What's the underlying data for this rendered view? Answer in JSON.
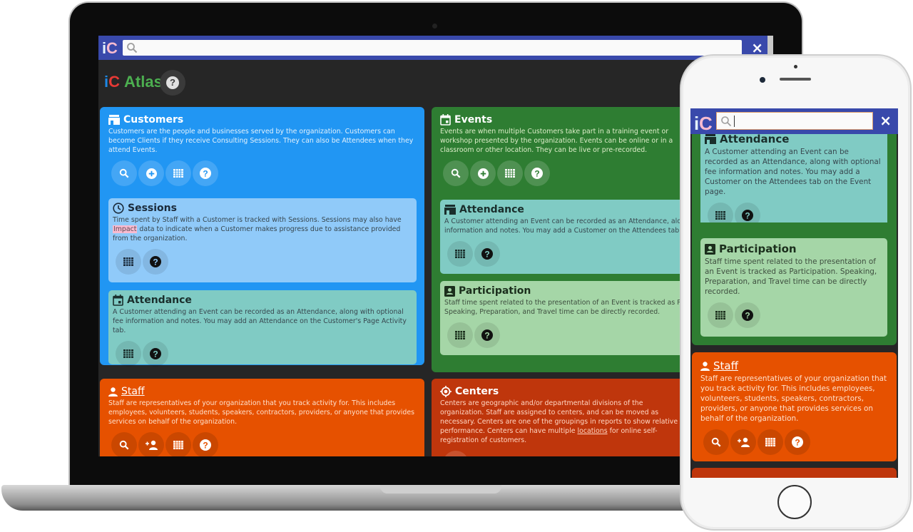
{
  "app": {
    "search": {
      "placeholder": "",
      "value": ""
    },
    "close_label": "×",
    "logo": {
      "i": "i",
      "c": "C"
    },
    "title": {
      "prefix_i": "i",
      "prefix_c": "C",
      "word": "Atlas"
    },
    "help_label": "?"
  },
  "colors": {
    "topbar": "#3949ab",
    "customers": "#2196f3",
    "events": "#2e7d32",
    "staff": "#e65100",
    "centers": "#bf360c",
    "sessions": "#90caf9",
    "attendance": "#80cbc4",
    "participation": "#a5d6a7"
  },
  "laptop": {
    "customers": {
      "title": "Customers",
      "icon": "store-icon",
      "description": "Customers are the people and businesses served by the organization. Customers can become Clients if they receive Consulting Sessions. They can also be Attendees when they attend Events.",
      "buttons": [
        "search",
        "add",
        "grid",
        "help"
      ],
      "sessions": {
        "title": "Sessions",
        "icon": "clock-icon",
        "description_before": "Time spent by Staff with a Customer is tracked with Sessions. Sessions may also have ",
        "highlight": "Impact",
        "description_after": " data to indicate when a Customer makes progress due to assistance provided from the organization.",
        "buttons": [
          "grid",
          "help"
        ]
      },
      "attendance": {
        "title": "Attendance",
        "icon": "calendar-icon",
        "description": "A Customer attending an Event can be recorded as an Attendance, along with optional fee information and notes. You may add an Attendance on the Customer's Page Activity tab.",
        "buttons": [
          "grid",
          "help"
        ]
      }
    },
    "events": {
      "title": "Events",
      "icon": "calendar-icon",
      "description": "Events are when multiple Customers take part in a training event or workshop presented by the organization. Events can be online or in a classroom or other location. They can be live or pre-recorded.",
      "buttons": [
        "search",
        "add",
        "grid",
        "help"
      ],
      "attendance": {
        "title": "Attendance",
        "icon": "store-icon",
        "description": "A Customer attending an Event can be recorded as an Attendance, along with optional fee information and notes. You may add a Customer on the Attendees tab on the Event page.",
        "buttons": [
          "grid",
          "help"
        ]
      },
      "participation": {
        "title": "Participation",
        "icon": "badge-icon",
        "description": "Staff time spent related to the presentation of an Event is tracked as Participation. Speaking, Preparation, and Travel time can be directly recorded.",
        "buttons": [
          "grid",
          "help"
        ]
      }
    },
    "staff": {
      "title": "Staff",
      "icon": "person-icon",
      "description": "Staff are representatives of your organization that you track activity for. This includes employees, volunteers, students, speakers, contractors, providers, or anyone that provides services on behalf of the organization.",
      "buttons": [
        "search",
        "add-person",
        "grid",
        "help"
      ]
    },
    "centers": {
      "title": "Centers",
      "icon": "target-icon",
      "description_before": "Centers are geographic and/or departmental divisions of the organization. Staff are assigned to centers, and can be moved as necessary. Centers are one of the groupings in reports to show relative performance. Centers can have multiple ",
      "link": "locations",
      "description_after": " for online self-registration of customers.",
      "buttons": [
        "grid"
      ]
    }
  },
  "phone": {
    "attendance": {
      "title": "Attendance",
      "description": "A Customer attending an Event can be recorded as an Attendance, along with optional fee information and notes. You may add a Customer on the Attendees tab on the Event page."
    },
    "participation": {
      "title": "Participation",
      "description": "Staff time spent related to the presentation of an Event is tracked as Participation. Speaking, Preparation, and Travel time can be directly recorded."
    },
    "staff": {
      "title": "Staff",
      "description": "Staff are representatives of your organization that you track activity for. This includes employees, volunteers, students, speakers, contractors, providers, or anyone that provides services on behalf of the organization."
    }
  }
}
